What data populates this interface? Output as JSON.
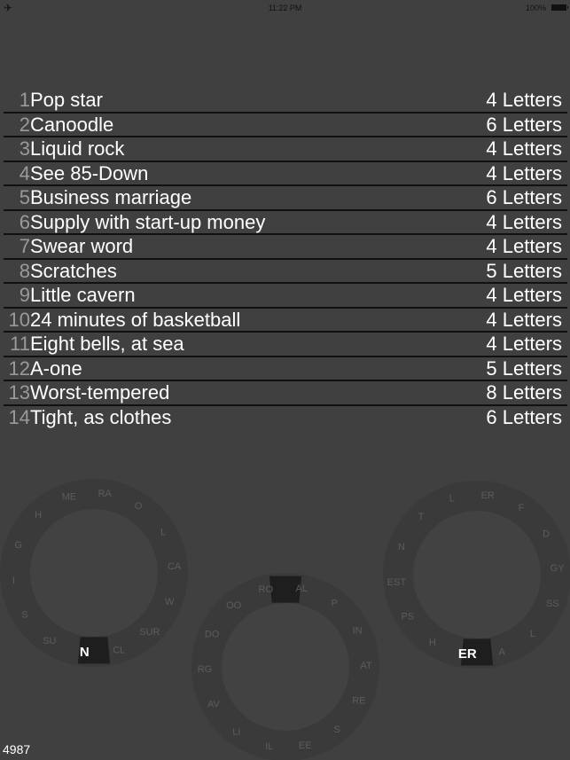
{
  "status_bar": {
    "airplane_icon": "airplane-icon",
    "time": "11:22 PM",
    "battery_percent": "100%",
    "battery_icon": "battery-icon"
  },
  "clues": [
    {
      "number": "1",
      "text": "Pop star",
      "length": "4 Letters"
    },
    {
      "number": "2",
      "text": "Canoodle",
      "length": "6 Letters"
    },
    {
      "number": "3",
      "text": "Liquid rock",
      "length": "4 Letters"
    },
    {
      "number": "4",
      "text": "See 85-Down",
      "length": "4 Letters"
    },
    {
      "number": "5",
      "text": "Business marriage",
      "length": "6 Letters"
    },
    {
      "number": "6",
      "text": "Supply with start-up money",
      "length": "4 Letters"
    },
    {
      "number": "7",
      "text": "Swear word",
      "length": "4 Letters"
    },
    {
      "number": "8",
      "text": "Scratches",
      "length": "5 Letters"
    },
    {
      "number": "9",
      "text": "Little cavern",
      "length": "4 Letters"
    },
    {
      "number": "10",
      "text": "24 minutes of basketball",
      "length": "4 Letters"
    },
    {
      "number": "11",
      "text": "Eight bells, at sea",
      "length": "4 Letters"
    },
    {
      "number": "12",
      "text": "A-one",
      "length": "5 Letters"
    },
    {
      "number": "13",
      "text": "Worst-tempered",
      "length": "8 Letters"
    },
    {
      "number": "14",
      "text": "Tight, as clothes",
      "length": "6 Letters"
    }
  ],
  "wheels": [
    {
      "name": "left",
      "selected": "N",
      "segments": [
        "N",
        "CL",
        "SUR",
        "W",
        "CA",
        "L",
        "O",
        "RA",
        "ME",
        "H",
        "G",
        "I",
        "S",
        "SU"
      ]
    },
    {
      "name": "middle",
      "selected": "",
      "segments": [
        "AL",
        "P",
        "IN",
        "AT",
        "RE",
        "S",
        "EE",
        "IL",
        "LI",
        "AV",
        "RG",
        "DO",
        "OO",
        "RO"
      ]
    },
    {
      "name": "right",
      "selected": "ER",
      "segments": [
        "ER",
        "A",
        "L",
        "SS",
        "GY",
        "D",
        "F",
        "ER",
        "L",
        "T",
        "N",
        "EST",
        "PS",
        "H"
      ]
    }
  ],
  "score": "4987",
  "colors": {
    "background": "#404040",
    "ring": "#3a3a3a",
    "hub": "#424242",
    "selector": "#1e1e1e",
    "segment_text": "#5c5c5c",
    "selected_text": "#ffffff",
    "clue_number": "#9a9a9a",
    "separator": "#111111"
  }
}
